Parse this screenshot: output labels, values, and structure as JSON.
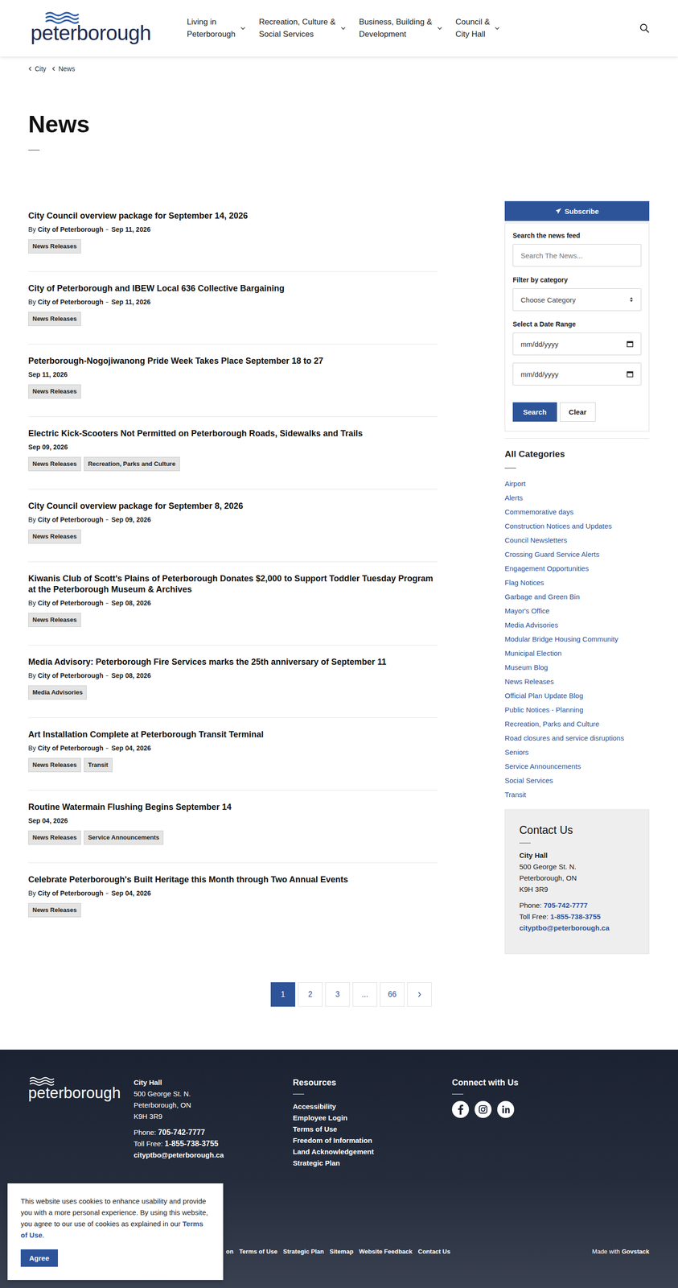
{
  "header": {
    "logo": "peterborough",
    "nav": [
      {
        "lines": [
          "Living in",
          "Peterborough"
        ]
      },
      {
        "lines": [
          "Recreation, Culture &",
          "Social Services"
        ]
      },
      {
        "lines": [
          "Business, Building &",
          "Development"
        ]
      },
      {
        "lines": [
          "Council &",
          "City Hall"
        ]
      }
    ]
  },
  "breadcrumb": [
    "City",
    "News"
  ],
  "page": {
    "title": "News"
  },
  "news": [
    {
      "title": "City Council overview package for September 14, 2026",
      "by": "By",
      "author": "City of Peterborough",
      "date": "Sep 11, 2026",
      "tags": [
        "News Releases"
      ]
    },
    {
      "title": "City of Peterborough and IBEW Local 636 Collective Bargaining",
      "by": "By",
      "author": "City of Peterborough",
      "date": "Sep 11, 2026",
      "tags": [
        "News Releases"
      ]
    },
    {
      "title": "Peterborough-Nogojiwanong Pride Week Takes Place September 18 to 27",
      "date": "Sep 11, 2026",
      "tags": [
        "News Releases"
      ]
    },
    {
      "title": "Electric Kick-Scooters Not Permitted on Peterborough Roads, Sidewalks and Trails",
      "date": "Sep 09, 2026",
      "tags": [
        "News Releases",
        "Recreation, Parks and Culture"
      ]
    },
    {
      "title": "City Council overview package for September 8, 2026",
      "by": "By",
      "author": "City of Peterborough",
      "date": "Sep 09, 2026",
      "tags": [
        "News Releases"
      ]
    },
    {
      "title": "Kiwanis Club of Scott's Plains of Peterborough Donates $2,000 to Support Toddler Tuesday Program at the Peterborough Museum & Archives",
      "by": "By",
      "author": "City of Peterborough",
      "date": "Sep 08, 2026",
      "tags": [
        "News Releases"
      ]
    },
    {
      "title": "Media Advisory: Peterborough Fire Services marks the 25th anniversary of September 11",
      "by": "By",
      "author": "City of Peterborough",
      "date": "Sep 08, 2026",
      "tags": [
        "Media Advisories"
      ]
    },
    {
      "title": "Art Installation Complete at Peterborough Transit Terminal",
      "by": "By",
      "author": "City of Peterborough",
      "date": "Sep 04, 2026",
      "tags": [
        "News Releases",
        "Transit"
      ]
    },
    {
      "title": "Routine Watermain Flushing Begins September 14",
      "date": "Sep 04, 2026",
      "tags": [
        "News Releases",
        "Service Announcements"
      ]
    },
    {
      "title": "Celebrate Peterborough's Built Heritage this Month through Two Annual Events",
      "by": "By",
      "author": "City of Peterborough",
      "date": "Sep 04, 2026",
      "tags": [
        "News Releases"
      ]
    }
  ],
  "pagination": [
    {
      "label": "1",
      "selected": true
    },
    {
      "label": "2",
      "selected": false
    },
    {
      "label": "3",
      "selected": false
    },
    {
      "label": "...",
      "selected": false
    },
    {
      "label": "66",
      "selected": false
    }
  ],
  "sidebar": {
    "subscribe": "Subscribe",
    "search_label": "Search the news feed",
    "search_placeholder": "Search The News...",
    "category_label": "Filter by category",
    "category_value": "Choose Category",
    "date_label": "Select a Date Range",
    "date_from": "mm/dd/yyyy",
    "date_to": "mm/dd/yyyy",
    "search_button": "Search",
    "clear_button": "Clear",
    "categories_title": "All Categories",
    "categories": [
      "Airport",
      "Alerts",
      "Commemorative days",
      "Construction Notices and Updates",
      "Council Newsletters",
      "Crossing Guard Service Alerts",
      "Engagement Opportunities",
      "Flag Notices",
      "Garbage and Green Bin",
      "Mayor's Office",
      "Media Advisories",
      "Modular Bridge Housing Community",
      "Municipal Election",
      "Museum Blog",
      "News Releases",
      "Official Plan Update Blog",
      "Public Notices - Planning",
      "Recreation, Parks and Culture",
      "Road closures and service disruptions",
      "Seniors",
      "Service Announcements",
      "Social Services",
      "Transit"
    ],
    "contact": {
      "title": "Contact Us",
      "name": "City Hall",
      "address": [
        "500 George St. N.",
        "Peterborough, ON",
        "K9H 3R9"
      ],
      "phone_label": "Phone:",
      "phone": "705-742-7777",
      "tollfree_label": "Toll Free:",
      "tollfree": "1-855-738-3755",
      "email": "cityptbo@peterborough.ca"
    }
  },
  "footer": {
    "logo": "peterborough",
    "name": "City Hall",
    "address": [
      "500 George St. N.",
      "Peterborough, ON",
      "K9H 3R9"
    ],
    "phone_label": "Phone:",
    "phone": "705-742-7777",
    "tollfree_label": "Toll Free:",
    "tollfree": "1-855-738-3755",
    "email": "cityptbo@peterborough.ca",
    "resources_title": "Resources",
    "resources": [
      "Accessibility",
      "Employee Login",
      "Terms of Use",
      "Freedom of Information",
      "Land Acknowledgement",
      "Strategic Plan"
    ],
    "connect_title": "Connect with Us",
    "bottom_links": [
      "on",
      "Terms of Use",
      "Strategic Plan",
      "Sitemap",
      "Website Feedback",
      "Contact Us"
    ],
    "made_with": "Made with",
    "made_by": "Govstack"
  },
  "cookie": {
    "text": "This website uses cookies to enhance usability and provide you with a more personal experience. By using this website, you agree to our use of cookies as explained in our",
    "link": "Terms of Use",
    "end": ".",
    "button": "Agree"
  }
}
